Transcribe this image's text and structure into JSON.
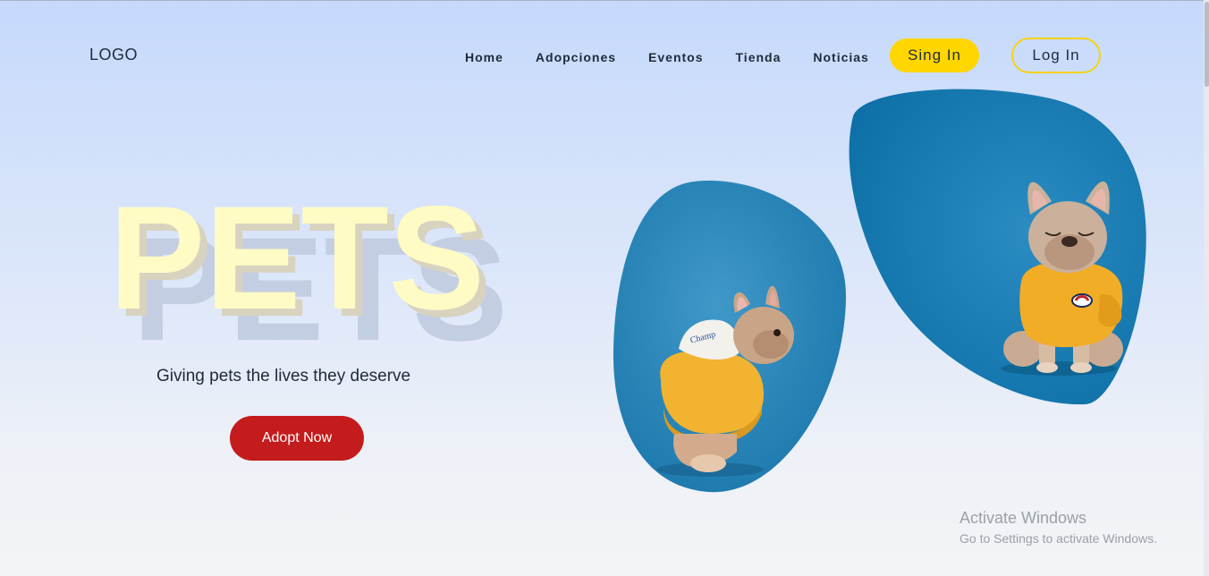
{
  "header": {
    "logo": "LOGO",
    "nav": [
      "Home",
      "Adopciones",
      "Eventos",
      "Tienda",
      "Noticias"
    ],
    "signin_label": "Sing In",
    "login_label": "Log In"
  },
  "hero": {
    "title": "PETS",
    "tagline": "Giving pets the lives they deserve",
    "cta_label": "Adopt Now"
  },
  "images": {
    "left": "french-bulldog-back-yellow-hoodie",
    "right": "french-bulldog-sitting-yellow-sweater"
  },
  "colors": {
    "accent_yellow": "#ffd600",
    "title_yellow": "#fffbc4",
    "cta_red": "#c41c1c",
    "photo_blue": "#1c7fb4"
  },
  "watermark": {
    "title": "Activate Windows",
    "subtitle": "Go to Settings to activate Windows."
  }
}
